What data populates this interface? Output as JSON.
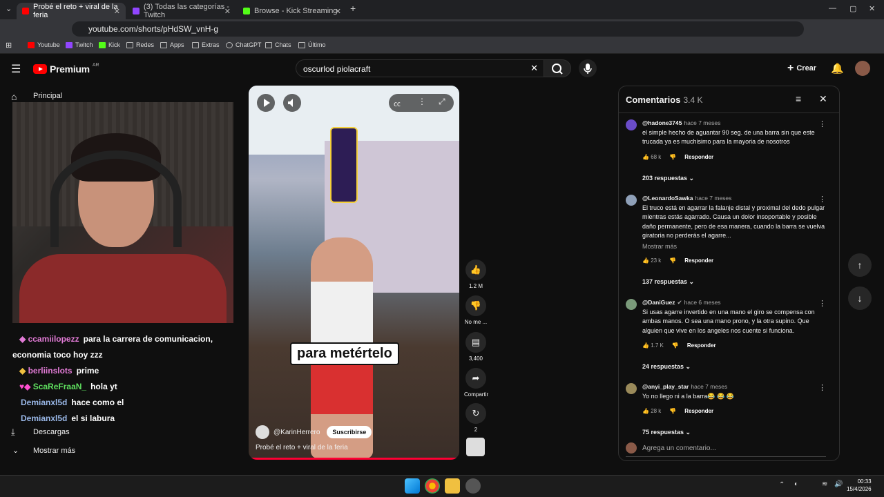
{
  "browser": {
    "tabs": [
      {
        "title": "Probé el reto + viral de la feria",
        "active": true
      },
      {
        "title": "(3) Todas las categorías - Twitch",
        "active": false
      },
      {
        "title": "Browse - Kick Streaming",
        "active": false
      }
    ],
    "url": "youtube.com/shorts/pHdSW_vnH-g",
    "bookmarks": [
      "Youtube",
      "Twitch",
      "Kick",
      "Redes",
      "Apps",
      "Extras",
      "ChatGPT",
      "Chats",
      "Último"
    ]
  },
  "youtube": {
    "logo": "Premium",
    "region": "AR",
    "search_value": "oscurlod piolacraft",
    "create_label": "Crear",
    "sidebar": {
      "home": "Principal",
      "downloads": "Descargas",
      "more": "Mostrar más"
    }
  },
  "stream_chat": [
    {
      "user": "ccamiilopezz",
      "msg": "para la carrera de comunicacion, economia toco hoy zzz",
      "color": "#e27bd6"
    },
    {
      "user": "berliinslots",
      "msg": "prime",
      "color": "#e27bd6"
    },
    {
      "user": "ScaReFraaN_",
      "msg": "hola yt",
      "color": "#5fe05f"
    },
    {
      "user": "Demianxl5d",
      "msg": "hace como el",
      "color": "#9ab8e8"
    },
    {
      "user": "Demianxl5d",
      "msg": "el si labura",
      "color": "#9ab8e8"
    }
  ],
  "short": {
    "caption": "para metértelo",
    "channel": "@KarinHerrero",
    "subscribe": "Suscribirse",
    "title": "Probé el reto + viral de la feria",
    "likes": "1.2 M",
    "dislike": "No me ...",
    "comments": "3,400",
    "share": "Compartir",
    "remix": "2"
  },
  "comments": {
    "title": "Comentarios",
    "count": "3.4 K",
    "items": [
      {
        "user": "@hadone3745",
        "time": "hace 7 meses",
        "text": "el simple hecho de aguantar 90 seg. de una barra sin que este trucada ya es muchisimo para la mayoria de nosotros",
        "likes": "68 k",
        "replies": "203 respuestas",
        "avatar": "#6a4cc8",
        "more": ""
      },
      {
        "user": "@LeonardoSawka",
        "time": "hace 7 meses",
        "text": "El truco está en agarrar la falanje distal y proximal del dedo pulgar mientras estás agarrado. Causa un dolor insoportable y posible daño permanente, pero de esa manera, cuando la barra se vuelva giratoria no perderás el agarre...",
        "likes": "23 k",
        "replies": "137 respuestas",
        "avatar": "#8fa0b8",
        "more": "Mostrar más"
      },
      {
        "user": "@DaniGuez",
        "time": "hace 6 meses",
        "text": "Si usas agarre invertido en una mano el giro se compensa con ambas manos. O sea una mano prono, y la otra supino. Que alguien que vive en los angeles nos cuente si funciona.",
        "likes": "1.7 K",
        "replies": "24 respuestas",
        "avatar": "#7a9a7a",
        "more": ""
      },
      {
        "user": "@anyi_play_star",
        "time": "hace 7 meses",
        "text": "Yo no llego ni a la barra😂 😂 😂",
        "likes": "28 k",
        "replies": "75 respuestas",
        "avatar": "#9a8a5a",
        "more": ""
      }
    ],
    "reply_label": "Responder",
    "add_placeholder": "Agrega un comentario..."
  },
  "taskbar": {
    "time": "00:33",
    "date": "15/4/2026"
  }
}
